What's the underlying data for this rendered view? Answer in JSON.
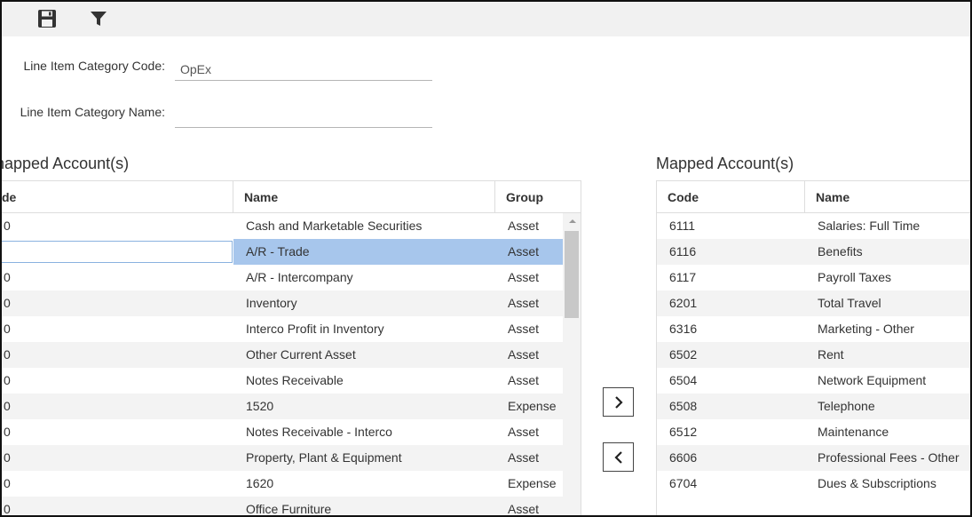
{
  "form": {
    "code_label": "Line Item Category Code:",
    "code_value": "OpEx",
    "name_label": "Line Item Category Name:",
    "name_value": ""
  },
  "left_grid": {
    "title": "Unmapped Account(s)",
    "visible_title": "napped Account(s)",
    "columns": [
      "Code",
      "Name",
      "Group"
    ],
    "visible_code_header": "de",
    "rows": [
      {
        "code": "0",
        "name": "Cash and Marketable Securities",
        "group": "Asset"
      },
      {
        "code": "",
        "name": "A/R - Trade",
        "group": "Asset"
      },
      {
        "code": "0",
        "name": "A/R - Intercompany",
        "group": "Asset"
      },
      {
        "code": "0",
        "name": "Inventory",
        "group": "Asset"
      },
      {
        "code": "0",
        "name": "Interco Profit in Inventory",
        "group": "Asset"
      },
      {
        "code": "0",
        "name": "Other Current Asset",
        "group": "Asset"
      },
      {
        "code": "0",
        "name": "Notes Receivable",
        "group": "Asset"
      },
      {
        "code": "0",
        "name": "1520",
        "group": "Expense"
      },
      {
        "code": "0",
        "name": "Notes Receivable - Interco",
        "group": "Asset"
      },
      {
        "code": "0",
        "name": "Property, Plant & Equipment",
        "group": "Asset"
      },
      {
        "code": "0",
        "name": "1620",
        "group": "Expense"
      },
      {
        "code": "0",
        "name": "Office Furniture",
        "group": "Asset"
      }
    ]
  },
  "right_grid": {
    "title": "Mapped Account(s)",
    "columns": [
      "Code",
      "Name"
    ],
    "rows": [
      {
        "code": "6111",
        "name": "Salaries: Full Time"
      },
      {
        "code": "6116",
        "name": "Benefits"
      },
      {
        "code": "6117",
        "name": "Payroll Taxes"
      },
      {
        "code": "6201",
        "name": "Total Travel"
      },
      {
        "code": "6316",
        "name": "Marketing - Other"
      },
      {
        "code": "6502",
        "name": "Rent"
      },
      {
        "code": "6504",
        "name": "Network Equipment"
      },
      {
        "code": "6508",
        "name": "Telephone"
      },
      {
        "code": "6512",
        "name": "Maintenance"
      },
      {
        "code": "6606",
        "name": "Professional Fees - Other"
      },
      {
        "code": "6704",
        "name": "Dues & Subscriptions"
      }
    ]
  },
  "selected_left_row": 1,
  "icons": {
    "save": "save-icon",
    "filter": "filter-icon",
    "move_right": "chevron-right-icon",
    "move_left": "chevron-left-icon"
  },
  "colors": {
    "selected_row": "#a7c6ec",
    "alt_row": "#f3f3f3",
    "toolbar": "#f1f1f1"
  }
}
